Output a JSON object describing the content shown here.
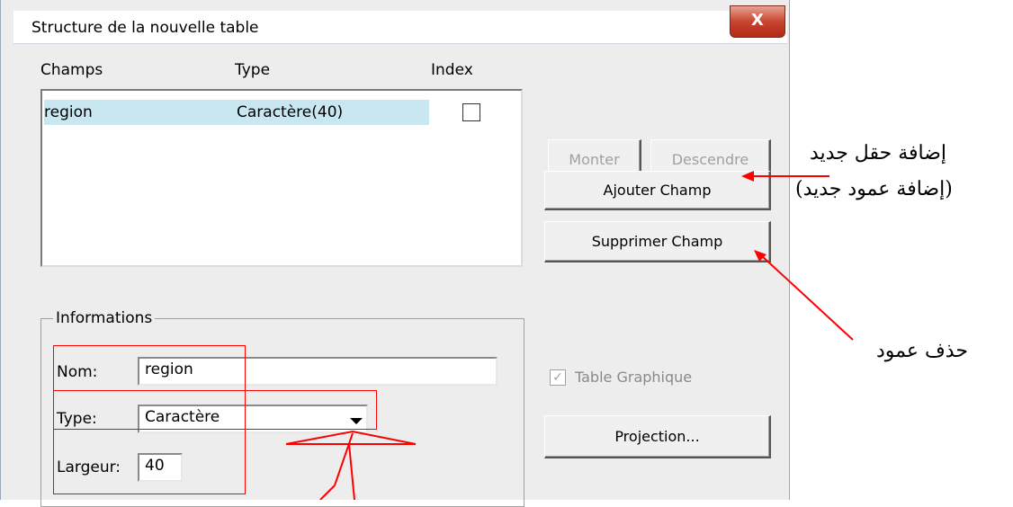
{
  "dialog": {
    "title": "Structure de la nouvelle table",
    "close_label": "X"
  },
  "fields_table": {
    "headers": [
      "Champs",
      "Type",
      "Index"
    ],
    "rows": [
      {
        "name": "region",
        "type": "Caractère(40)",
        "indexed": false
      }
    ]
  },
  "buttons": {
    "up": "Monter",
    "down": "Descendre",
    "add_field": "Ajouter Champ",
    "remove_field": "Supprimer Champ",
    "projection": "Projection..."
  },
  "information": {
    "group_title": "Informations",
    "name_label": "Nom:",
    "name_value": "region",
    "type_label": "Type:",
    "type_value": "Caractère",
    "width_label": "Largeur:",
    "width_value": "40"
  },
  "graphic_table": {
    "label": "Table Graphique",
    "checked": true
  },
  "annotations": {
    "add_field_line1": "إضافة حقل جديد",
    "add_field_line2": "(إضافة عمود جديد)",
    "remove_column": "حذف عمود"
  },
  "colors": {
    "annotation": "#ff0000",
    "selection": "#c8e7f1",
    "close_button": "#c8452f"
  }
}
